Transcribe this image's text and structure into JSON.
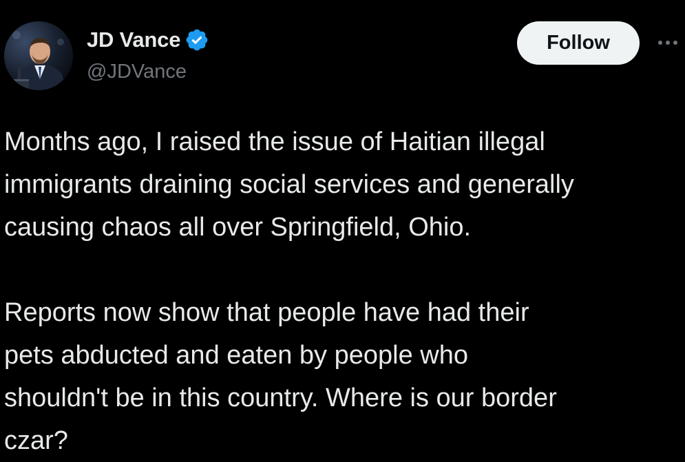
{
  "author": {
    "display_name": "JD Vance",
    "handle": "@JDVance",
    "verified": true,
    "verified_icon": "verified-badge-icon"
  },
  "actions": {
    "follow_label": "Follow",
    "more_icon": "more-options-icon"
  },
  "tweet": {
    "paragraphs": [
      {
        "lines": [
          "Months ago, I raised the issue of Haitian illegal",
          "immigrants draining social services and generally",
          "causing chaos all over Springfield, Ohio."
        ]
      },
      {
        "lines": [
          "Reports now show that people have had their",
          "pets abducted and eaten by people who",
          "shouldn't be in this country. Where is our border",
          "czar?"
        ]
      }
    ]
  },
  "colors": {
    "background": "#000000",
    "primary_text": "#e7e9ea",
    "secondary_text": "#71767b",
    "verified_blue": "#1d9bf0",
    "follow_button_bg": "#eff3f4",
    "follow_button_text": "#0f1419"
  }
}
